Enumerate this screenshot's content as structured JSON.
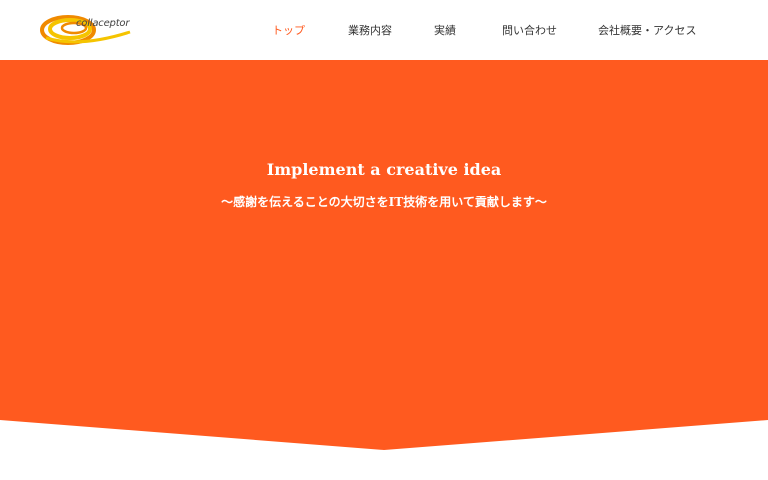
{
  "header": {
    "logo_text": "collaceptor",
    "nav": [
      {
        "label": "トップ",
        "active": true
      },
      {
        "label": "業務内容",
        "active": false
      },
      {
        "label": "実績",
        "active": false
      },
      {
        "label": "問い合わせ",
        "active": false
      },
      {
        "label": "会社概要・アクセス",
        "active": false
      }
    ]
  },
  "hero": {
    "title": "Implement a creative idea",
    "subtitle": "〜感謝を伝えることの大切さをIT技術を用いて貢献します〜"
  },
  "colors": {
    "accent": "#ff5a1f",
    "logo_yellow": "#f5c400",
    "logo_orange": "#f08a00",
    "nav_text": "#333333",
    "background": "#ffffff"
  }
}
